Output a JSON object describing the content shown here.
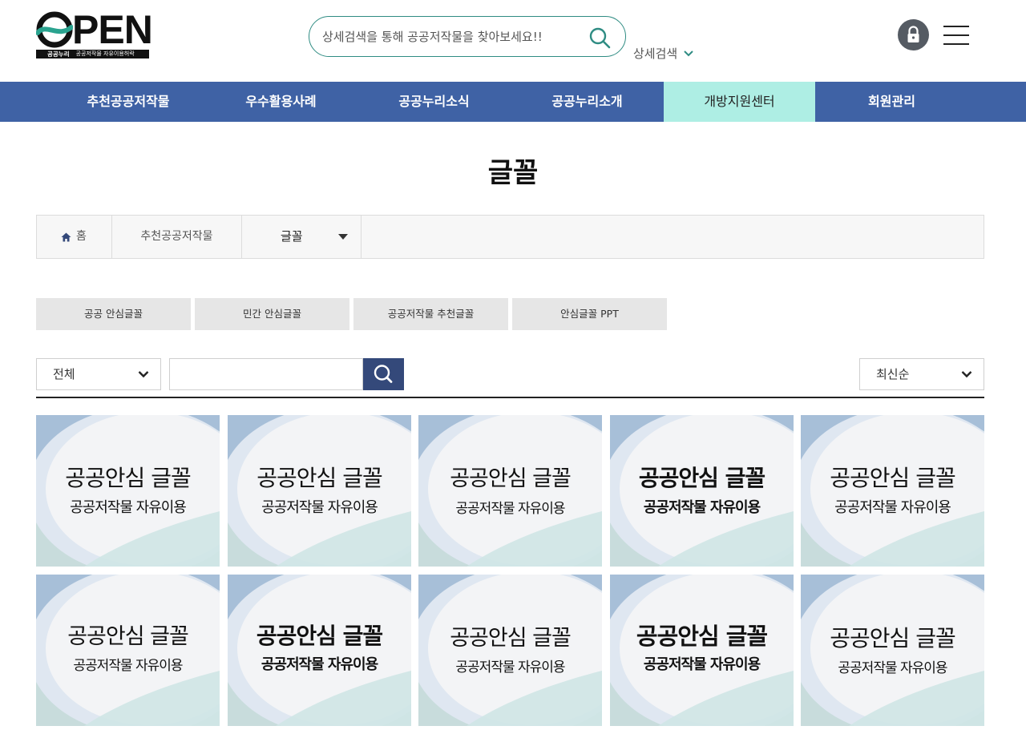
{
  "header": {
    "logo_text": "PEN",
    "logo_sub1": "공공누리",
    "logo_sub2": "공공저작물 자유이용허락",
    "search_placeholder": "상세검색을 통해 공공저작물을 찾아보세요!!",
    "advanced_search_label": "상세검색"
  },
  "nav": {
    "items": [
      {
        "label": "추천공공저작물"
      },
      {
        "label": "우수활용사례"
      },
      {
        "label": "공공누리소식"
      },
      {
        "label": "공공누리소개"
      },
      {
        "label": "개방지원센터",
        "active": true
      },
      {
        "label": "회원관리"
      }
    ]
  },
  "page": {
    "title": "글꼴"
  },
  "breadcrumb": {
    "home": "홈",
    "level1": "추천공공저작물",
    "current": "글꼴"
  },
  "tabs": [
    {
      "label": "공공 안심글꼴"
    },
    {
      "label": "민간 안심글꼴"
    },
    {
      "label": "공공저작물 추천글꼴"
    },
    {
      "label": "안심글꼴 PPT"
    }
  ],
  "filter": {
    "category_selected": "전체",
    "keyword_value": "",
    "sort_selected": "최신순"
  },
  "cards": [
    {
      "title": "공공안심 글꼴",
      "subtitle": "공공저작물 자유이용"
    },
    {
      "title": "공공안심 글꼴",
      "subtitle": "공공저작물 자유이용"
    },
    {
      "title": "공공안심 글꼴",
      "subtitle": "공공저작물 자유이용"
    },
    {
      "title": "공공안심 글꼴",
      "subtitle": "공공저작물 자유이용"
    },
    {
      "title": "공공안심 글꼴",
      "subtitle": "공공저작물 자유이용"
    },
    {
      "title": "공공안심 글꼴",
      "subtitle": "공공저작물 자유이용"
    },
    {
      "title": "공공안심 글꼴",
      "subtitle": "공공저작물 자유이용"
    },
    {
      "title": "공공안심 글꼴",
      "subtitle": "공공저작물 자유이용"
    },
    {
      "title": "공공안심 글꼴",
      "subtitle": "공공저작물 자유이용"
    },
    {
      "title": "공공안심 글꼴",
      "subtitle": "공공저작물 자유이용"
    }
  ],
  "colors": {
    "nav_bg": "#3f62a5",
    "nav_active_bg": "#aeeee4",
    "search_border": "#2f8c83",
    "search_button_bg": "#34497a"
  }
}
